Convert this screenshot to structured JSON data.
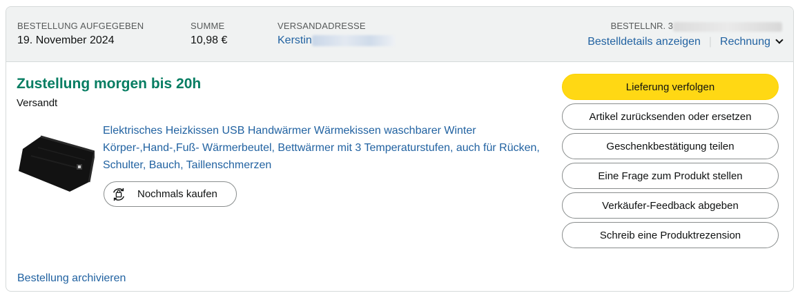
{
  "header": {
    "ordered_label": "BESTELLUNG AUFGEGEBEN",
    "ordered_value": "19. November 2024",
    "total_label": "SUMME",
    "total_value": "10,98 €",
    "ship_label": "VERSANDADRESSE",
    "ship_value": "Kerstin",
    "ordernr_label": "BESTELLNR. 3",
    "details_link": "Bestelldetails anzeigen",
    "invoice_link": "Rechnung"
  },
  "delivery": {
    "title": "Zustellung morgen bis 20h",
    "status": "Versandt"
  },
  "product": {
    "title": "Elektrisches Heizkissen USB Handwärmer Wärmekissen waschbarer Winter Körper-,Hand-,Fuß- Wärmerbeutel, Bettwärmer mit 3 Temperaturstufen, auch für Rücken, Schulter, Bauch, Taillenschmerzen",
    "buy_again": "Nochmals kaufen"
  },
  "actions": [
    "Lieferung verfolgen",
    "Artikel zurücksenden oder ersetzen",
    "Geschenkbestätigung teilen",
    "Eine Frage zum Produkt stellen",
    "Verkäufer-Feedback abgeben",
    "Schreib eine Produktrezension"
  ],
  "footer": {
    "archive_link": "Bestellung archivieren"
  },
  "colors": {
    "link": "#2162a1",
    "delivery_green": "#067d62",
    "primary_button": "#ffd814",
    "header_bg": "#f0f2f2"
  },
  "icons": {
    "buy_again": "shopping-bag-refresh-icon",
    "invoice": "chevron-down-icon"
  }
}
